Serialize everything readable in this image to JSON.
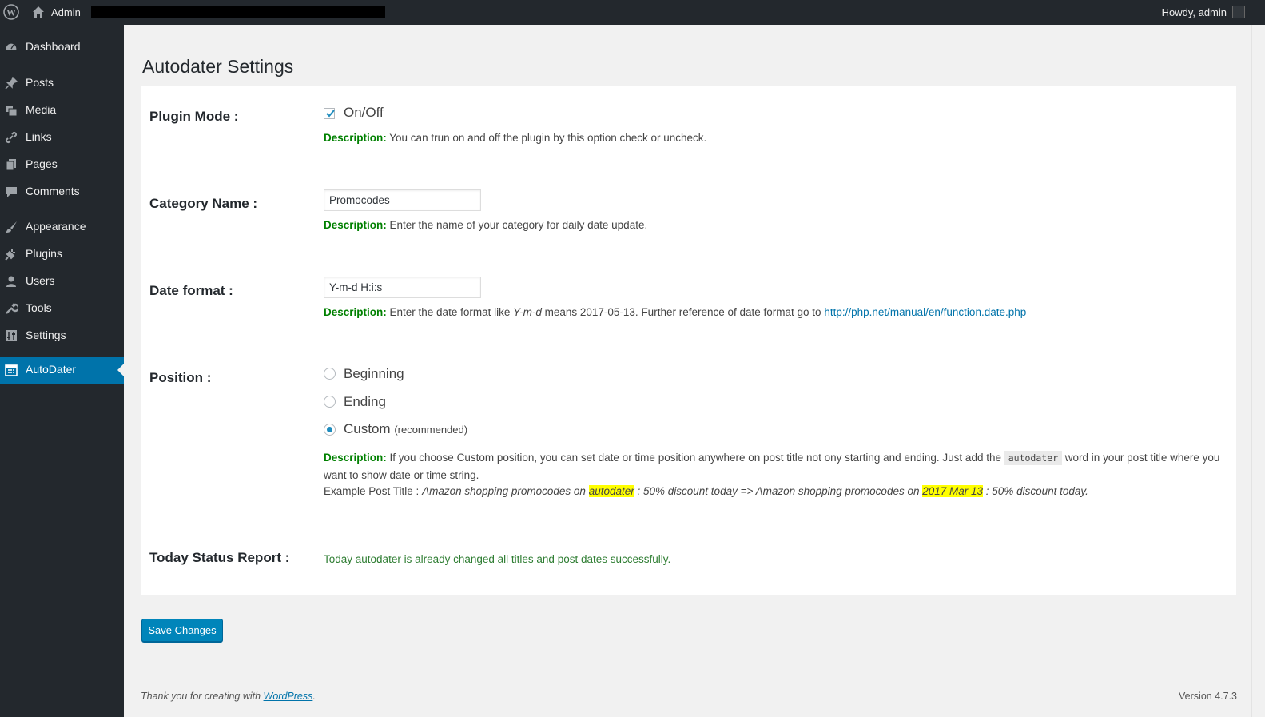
{
  "adminbar": {
    "site_name": "Admin",
    "howdy": "Howdy, admin"
  },
  "sidebar": {
    "items": [
      {
        "label": "Dashboard",
        "icon": "dashboard-icon"
      },
      {
        "label": "Posts",
        "icon": "pin-icon"
      },
      {
        "label": "Media",
        "icon": "media-icon"
      },
      {
        "label": "Links",
        "icon": "link-icon"
      },
      {
        "label": "Pages",
        "icon": "pages-icon"
      },
      {
        "label": "Comments",
        "icon": "comment-icon"
      },
      {
        "label": "Appearance",
        "icon": "brush-icon"
      },
      {
        "label": "Plugins",
        "icon": "plug-icon"
      },
      {
        "label": "Users",
        "icon": "user-icon"
      },
      {
        "label": "Tools",
        "icon": "wrench-icon"
      },
      {
        "label": "Settings",
        "icon": "settings-icon"
      },
      {
        "label": "AutoDater",
        "icon": "calendar-icon",
        "active": true
      }
    ]
  },
  "page": {
    "title": "Autodater Settings"
  },
  "settings": {
    "plugin_mode": {
      "label": "Plugin Mode :",
      "checkbox_label": "On/Off",
      "checked": true,
      "desc_prefix": "Description:",
      "desc": " You can trun on and off the plugin by this option check or uncheck."
    },
    "category": {
      "label": "Category Name :",
      "value": "Promocodes",
      "desc_prefix": "Description:",
      "desc": " Enter the name of your category for daily date update."
    },
    "date_format": {
      "label": "Date format :",
      "value": "Y-m-d H:i:s",
      "desc_prefix": "Description:",
      "desc_a": " Enter the date format like ",
      "desc_italic": "Y-m-d",
      "desc_b": " means 2017-05-13. Further reference of date format go to ",
      "link": "http://php.net/manual/en/function.date.php"
    },
    "position": {
      "label": "Position :",
      "options": [
        {
          "label": "Beginning",
          "checked": false
        },
        {
          "label": "Ending",
          "checked": false
        },
        {
          "label": "Custom",
          "note": "(recommended)",
          "checked": true
        }
      ],
      "desc_prefix": "Description:",
      "desc_a": " If you choose Custom position, you can set date or time position anywhere on post title not ony starting and ending. Just add the ",
      "code": "autodater",
      "desc_b": " word in your post title where you want to show date or time string.",
      "example_prefix": "Example Post Title : ",
      "example_a": "Amazon shopping promocodes on ",
      "example_hl1": "autodater",
      "example_b": " : 50% discount today => Amazon shopping promocodes on ",
      "example_hl2": "2017 Mar 13",
      "example_c": " : 50% discount today."
    },
    "status": {
      "label": "Today Status Report :",
      "text": "Today autodater is already changed all titles and post dates successfully."
    }
  },
  "save_button": "Save Changes",
  "footer": {
    "thanks_a": "Thank you for creating with ",
    "thanks_link": "WordPress",
    "thanks_b": ".",
    "version": "Version 4.7.3"
  },
  "colors": {
    "adminbar_bg": "#23282d",
    "active_menu": "#0073aa",
    "description_green": "#008000",
    "status_green": "#2e7d32",
    "highlight": "#ffff00",
    "button": "#0085ba"
  }
}
